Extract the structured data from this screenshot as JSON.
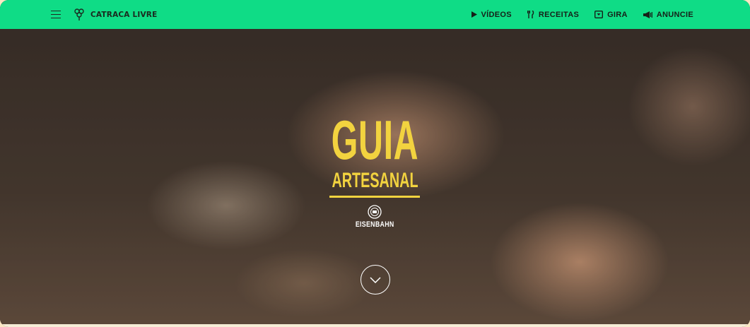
{
  "colors": {
    "topbar_bg": "#0fdc86",
    "accent_yellow": "#f2d33f",
    "nav_text": "#162018"
  },
  "header": {
    "menu_icon": "hamburger-icon",
    "brand_icon": "catraca-logo-icon",
    "brand_name": "CATRACA LIVRE",
    "nav": [
      {
        "icon": "play-icon",
        "label": "VÍDEOS"
      },
      {
        "icon": "cutlery-icon",
        "label": "RECEITAS"
      },
      {
        "icon": "ticket-icon",
        "label": "GIRA"
      },
      {
        "icon": "megaphone-icon",
        "label": "ANUNCIE"
      }
    ]
  },
  "hero": {
    "title_main": "GUIA",
    "title_sub": "ARTESANAL",
    "sponsor_name": "EISENBAHN",
    "scroll_icon": "chevron-down-icon"
  }
}
